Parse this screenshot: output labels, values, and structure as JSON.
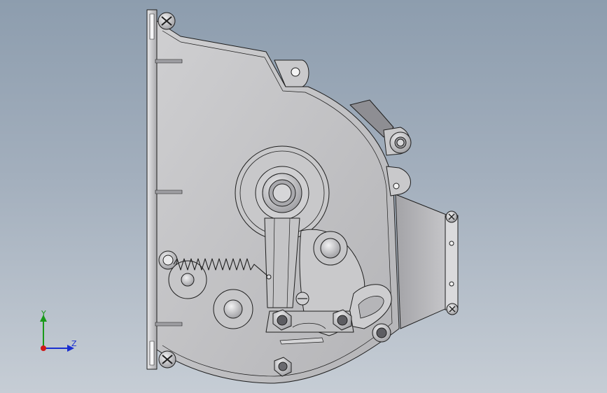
{
  "viewport": {
    "background_top": "#8d9dae",
    "background_bottom": "#c6cdd5"
  },
  "model": {
    "part_color": "#c2c2c4",
    "edge_color": "#1e1e1e"
  },
  "triad": {
    "y_label": "Y",
    "z_label": "Z",
    "y_color": "#1a9a1a",
    "z_color": "#1a2fd0",
    "x_color": "#d01818"
  }
}
